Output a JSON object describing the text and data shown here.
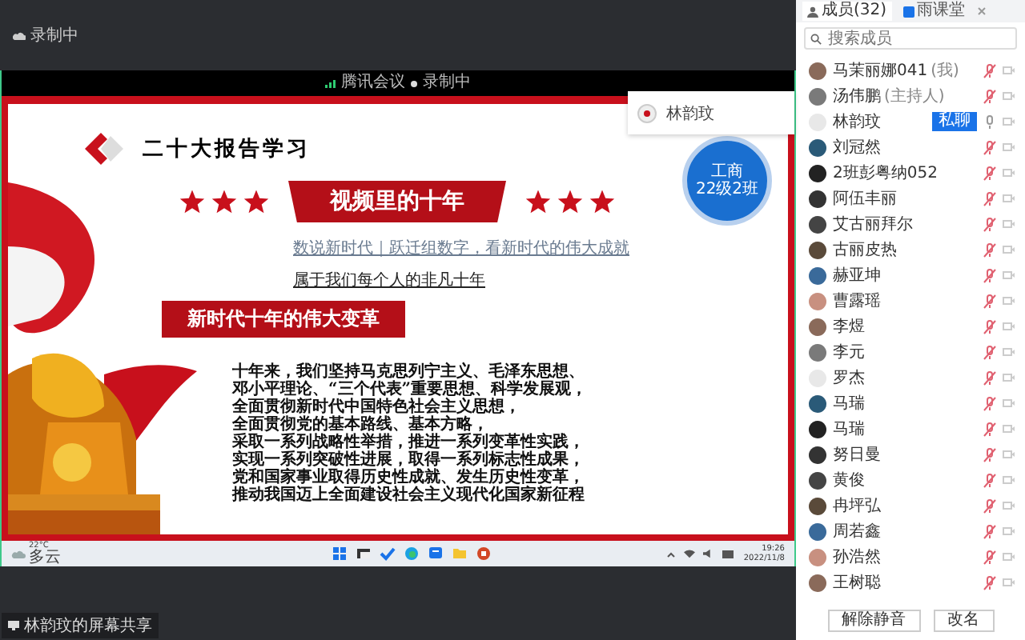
{
  "recording_label": "录制中",
  "share_bar": {
    "app": "腾讯会议",
    "recording": "录制中"
  },
  "slide": {
    "title": "二十大报告学习",
    "banner": "视频里的十年",
    "links": [
      "数说新时代｜跃迁组数字，看新时代的伟大成就",
      "属于我们每个人的非凡十年"
    ],
    "section": "新时代十年的伟大变革",
    "body": [
      "十年来，我们坚持马克思列宁主义、毛泽东思想、",
      "邓小平理论、“三个代表”重要思想、科学发展观，",
      "全面贯彻新时代中国特色社会主义思想，",
      "全面贯彻党的基本路线、基本方略，",
      "采取一系列战略性举措，推进一系列变革性实践，",
      "实现一系列突破性进展，取得一系列标志性成果，",
      "党和国家事业取得历史性成就、发生历史性变革，",
      "推动我国迈上全面建设社会主义现代化国家新征程"
    ],
    "stamp": [
      "工商",
      "22级2班"
    ]
  },
  "speaker_card": {
    "name": "林韵玟"
  },
  "taskbar": {
    "temperature": "22°C",
    "weather": "多云",
    "time": "19:26",
    "date": "2022/11/8"
  },
  "share_label": "林韵玟的屏幕共享",
  "panel": {
    "tabs": [
      {
        "label": "成员(32)",
        "selected": true
      },
      {
        "label": "雨课堂",
        "selected": false
      }
    ],
    "search": {
      "placeholder": "搜索成员"
    },
    "members": [
      {
        "name": "马茉丽娜041",
        "note": "(我)",
        "muted": true
      },
      {
        "name": "汤伟鹏",
        "note": "(主持人)",
        "muted": true
      },
      {
        "name": "林韵玟",
        "muted": false,
        "action": "私聊"
      },
      {
        "name": "刘冠然",
        "muted": true
      },
      {
        "name": "2班彭粤纳052",
        "muted": true
      },
      {
        "name": "阿伍丰丽",
        "muted": true
      },
      {
        "name": "艾古丽拜尔",
        "muted": true
      },
      {
        "name": "古丽皮热",
        "muted": true
      },
      {
        "name": "赫亚坤",
        "muted": true
      },
      {
        "name": "曹露瑶",
        "muted": true
      },
      {
        "name": "李煜",
        "muted": true
      },
      {
        "name": "李元",
        "muted": true
      },
      {
        "name": "罗杰",
        "muted": true
      },
      {
        "name": "马瑞",
        "muted": true
      },
      {
        "name": "马瑞",
        "muted": true
      },
      {
        "name": "努日曼",
        "muted": true
      },
      {
        "name": "黄俊",
        "muted": true
      },
      {
        "name": "冉坪弘",
        "muted": true
      },
      {
        "name": "周若鑫",
        "muted": true
      },
      {
        "name": "孙浩然",
        "muted": true
      },
      {
        "name": "王树聪",
        "muted": true
      }
    ],
    "buttons": [
      "解除静音",
      "改名"
    ]
  }
}
